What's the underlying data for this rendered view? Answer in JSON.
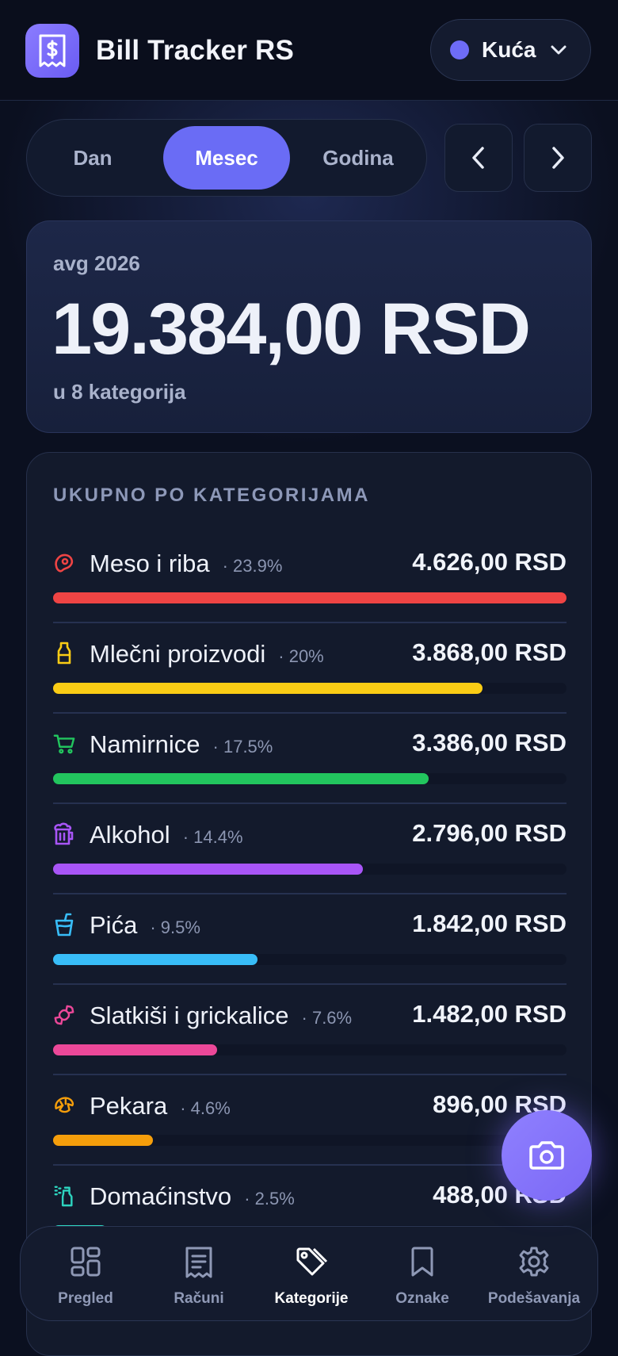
{
  "header": {
    "app_title": "Bill Tracker RS",
    "household": {
      "name": "Kuća",
      "color": "#6e6cf8"
    }
  },
  "period": {
    "tabs": [
      "Dan",
      "Mesec",
      "Godina"
    ],
    "active": "Mesec"
  },
  "summary": {
    "period_label": "avg 2026",
    "total": "19.384,00 RSD",
    "subtitle": "u 8 kategorija"
  },
  "categories": {
    "heading": "UKUPNO PO KATEGORIJAMA",
    "items": [
      {
        "name": "Meso i riba",
        "pct": "· 23.9%",
        "amount": "4.626,00 RSD",
        "share": 1.0,
        "color": "#ef4444",
        "icon": "meat-icon"
      },
      {
        "name": "Mlečni proizvodi",
        "pct": "· 20%",
        "amount": "3.868,00 RSD",
        "share": 0.836,
        "color": "#facc15",
        "icon": "milk-bottle-icon"
      },
      {
        "name": "Namirnice",
        "pct": "· 17.5%",
        "amount": "3.386,00 RSD",
        "share": 0.732,
        "color": "#22c55e",
        "icon": "cart-icon"
      },
      {
        "name": "Alkohol",
        "pct": "· 14.4%",
        "amount": "2.796,00 RSD",
        "share": 0.604,
        "color": "#a855f7",
        "icon": "beer-mug-icon"
      },
      {
        "name": "Pića",
        "pct": "· 9.5%",
        "amount": "1.842,00 RSD",
        "share": 0.398,
        "color": "#38bdf8",
        "icon": "cup-straw-icon"
      },
      {
        "name": "Slatkiši i grickalice",
        "pct": "· 7.6%",
        "amount": "1.482,00 RSD",
        "share": 0.32,
        "color": "#ec4899",
        "icon": "candy-icon"
      },
      {
        "name": "Pekara",
        "pct": "· 4.6%",
        "amount": "896,00 RSD",
        "share": 0.194,
        "color": "#f59e0b",
        "icon": "croissant-icon"
      },
      {
        "name": "Domaćinstvo",
        "pct": "· 2.5%",
        "amount": "488,00 RSD",
        "share": 0.105,
        "color": "#2dd4bf",
        "icon": "spray-bottle-icon"
      }
    ]
  },
  "bottom_nav": {
    "items": [
      {
        "label": "Pregled",
        "icon": "grid-icon"
      },
      {
        "label": "Računi",
        "icon": "receipt-icon"
      },
      {
        "label": "Kategorije",
        "icon": "tag-icon"
      },
      {
        "label": "Oznake",
        "icon": "bookmark-icon"
      },
      {
        "label": "Podešavanja",
        "icon": "gear-icon"
      }
    ],
    "active": "Kategorije"
  },
  "fab": {
    "icon": "camera-icon"
  }
}
